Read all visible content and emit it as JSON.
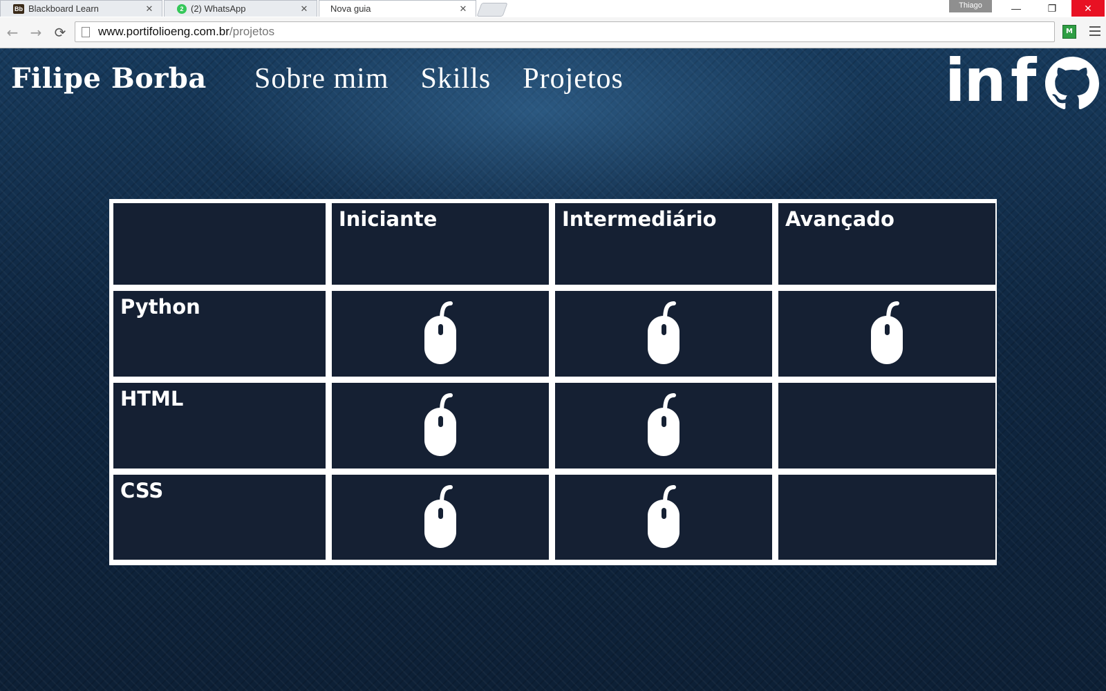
{
  "browser": {
    "tabs": [
      {
        "favicon": "Bb",
        "title": "Blackboard Learn",
        "active": false
      },
      {
        "favicon": "2",
        "title": "(2) WhatsApp",
        "active": false
      },
      {
        "favicon": "",
        "title": "Nova guia",
        "active": true
      }
    ],
    "close_glyph": "✕",
    "user_name": "Thiago",
    "window_buttons": {
      "minimize": "—",
      "maximize": "❐",
      "close": "✕"
    },
    "address": {
      "host": "www.portifolioeng.com.br",
      "path": "/projetos"
    },
    "extension_label": "M"
  },
  "site": {
    "brand": "Filipe Borba",
    "nav": [
      "Sobre mim",
      "Skills",
      "Projetos"
    ],
    "social": {
      "linkedin": "in",
      "facebook": "f",
      "github": "github-icon"
    }
  },
  "skills_table": {
    "columns": [
      "Iniciante",
      "Intermediário",
      "Avançado"
    ],
    "rows": [
      {
        "label": "Python",
        "levels": [
          true,
          true,
          true
        ]
      },
      {
        "label": "HTML",
        "levels": [
          true,
          true,
          false
        ]
      },
      {
        "label": "CSS",
        "levels": [
          true,
          true,
          false
        ]
      }
    ],
    "marker_icon": "mouse-icon"
  },
  "colors": {
    "page_background": "#112a44",
    "cell_background": "#152033",
    "table_border": "#ffffff",
    "close_button": "#e81123"
  }
}
